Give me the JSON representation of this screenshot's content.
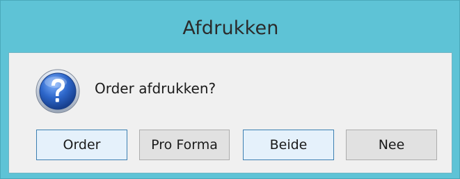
{
  "window": {
    "title": "Afdrukken"
  },
  "dialog": {
    "icon": "question-icon",
    "message": "Order afdrukken?"
  },
  "buttons": [
    {
      "label": "Order",
      "default": true
    },
    {
      "label": "Pro Forma",
      "default": false
    },
    {
      "label": "Beide",
      "default": true
    },
    {
      "label": "Nee",
      "default": false
    }
  ],
  "colors": {
    "titlebar": "#5ec3d6",
    "client_bg": "#f0f0f0",
    "button_bg": "#e1e1e1",
    "button_focus_bg": "#e5f1fb",
    "button_focus_border": "#3c7fb1",
    "icon_blue": "#2a5fb8"
  }
}
